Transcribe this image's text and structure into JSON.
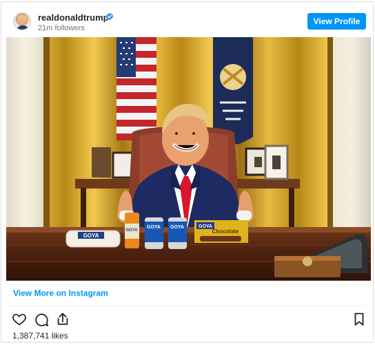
{
  "profile": {
    "username": "realdonaldtrump",
    "followers": "21m followers",
    "view_profile_label": "View Profile",
    "verified_color": "#3897f0"
  },
  "post": {
    "image_description_icon": "photo",
    "products": [
      "GOYA",
      "GOYA",
      "GOYA",
      "GOYA",
      "Chocolate"
    ],
    "view_more_label": "View More on Instagram",
    "likes": "1,387,741 likes"
  },
  "actions": {
    "like_icon": "heart-icon",
    "comment_icon": "comment-icon",
    "share_icon": "share-icon",
    "save_icon": "bookmark-icon"
  },
  "colors": {
    "accent": "#0095f6",
    "text": "#262626",
    "secondary_text": "#737373",
    "border": "#dbdbdb"
  }
}
